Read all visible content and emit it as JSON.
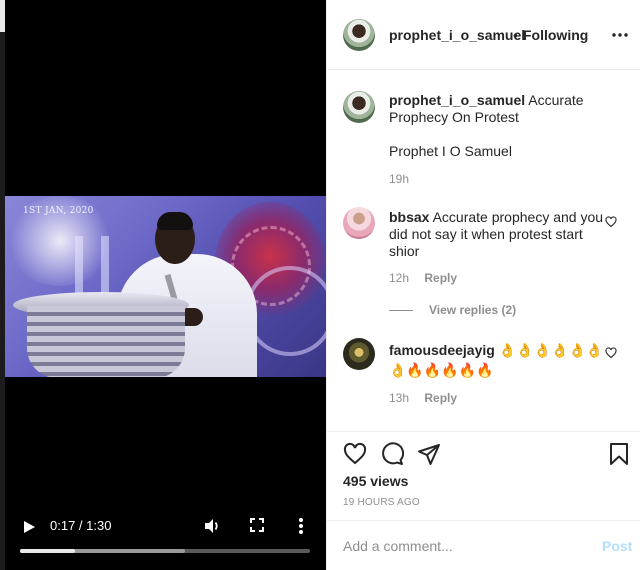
{
  "video": {
    "date_stamp": "1ST JAN, 2020",
    "current_time": "0:17",
    "duration": "1:30",
    "time_display": "0:17 / 1:30",
    "progress": 0.19,
    "buffered": 0.57,
    "icons": {
      "play": "play-icon",
      "volume": "volume-icon",
      "fullscreen": "fullscreen-icon",
      "more": "more-vertical-icon"
    }
  },
  "header": {
    "username": "prophet_i_o_samuel",
    "separator": "•",
    "follow_status": "Following",
    "more_icon": "more-horizontal-icon"
  },
  "caption": {
    "username": "prophet_i_o_samuel",
    "text": "Accurate Prophecy On Protest",
    "line2": "Prophet I O Samuel",
    "time": "19h"
  },
  "comments": [
    {
      "username": "bbsax",
      "text": "Accurate prophecy and you did not say it when protest start shior",
      "time": "12h",
      "reply_label": "Reply",
      "view_replies": "View replies (2)"
    },
    {
      "username": "famousdeejayig",
      "text": "👌👌👌👌👌👌👌🔥🔥🔥🔥🔥",
      "time": "13h",
      "reply_label": "Reply"
    }
  ],
  "actions": {
    "icons": [
      "heart-icon",
      "comment-icon",
      "share-icon",
      "bookmark-icon"
    ],
    "views": "495 views",
    "time_ago": "19 HOURS AGO"
  },
  "comment_box": {
    "placeholder": "Add a comment...",
    "post_label": "Post"
  },
  "colors": {
    "text": "#262626",
    "muted": "#8e8e8e",
    "border": "#efefef",
    "post_disabled": "#b2dffc",
    "video_bg": "#000000"
  }
}
